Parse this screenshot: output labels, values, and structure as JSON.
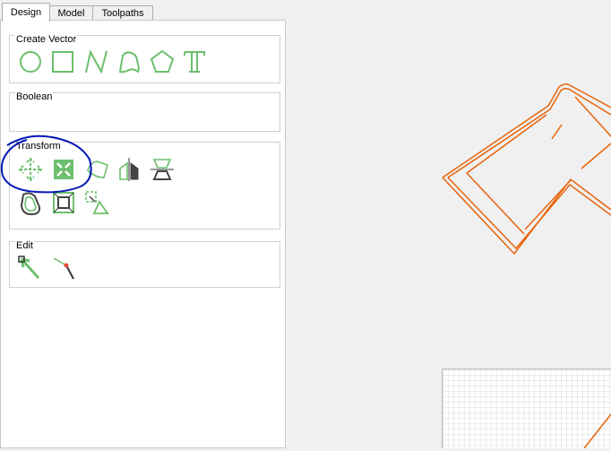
{
  "tabs": [
    {
      "label": "Design",
      "active": true
    },
    {
      "label": "Model",
      "active": false
    },
    {
      "label": "Toolpaths",
      "active": false
    }
  ],
  "groups": {
    "create_vector": {
      "title": "Create Vector",
      "tools": [
        "circle-icon",
        "rectangle-icon",
        "polyline-icon",
        "freeform-shape-icon",
        "polygon-icon",
        "text-icon"
      ]
    },
    "boolean": {
      "title": "Boolean"
    },
    "transform": {
      "title": "Transform",
      "tools": [
        "move-icon",
        "scale-icon",
        "rotate-icon",
        "mirror-icon",
        "align-icon",
        "offset-icon",
        "fit-to-box-icon",
        "distort-icon"
      ]
    },
    "edit": {
      "title": "Edit",
      "tools": [
        "node-edit-icon",
        "curve-fit-icon"
      ]
    }
  },
  "colors": {
    "vector_orange": "#e8630a",
    "tool_green": "#6cbf6c",
    "annotation_blue": "#0016b8",
    "grid": "#d8d8d8"
  }
}
